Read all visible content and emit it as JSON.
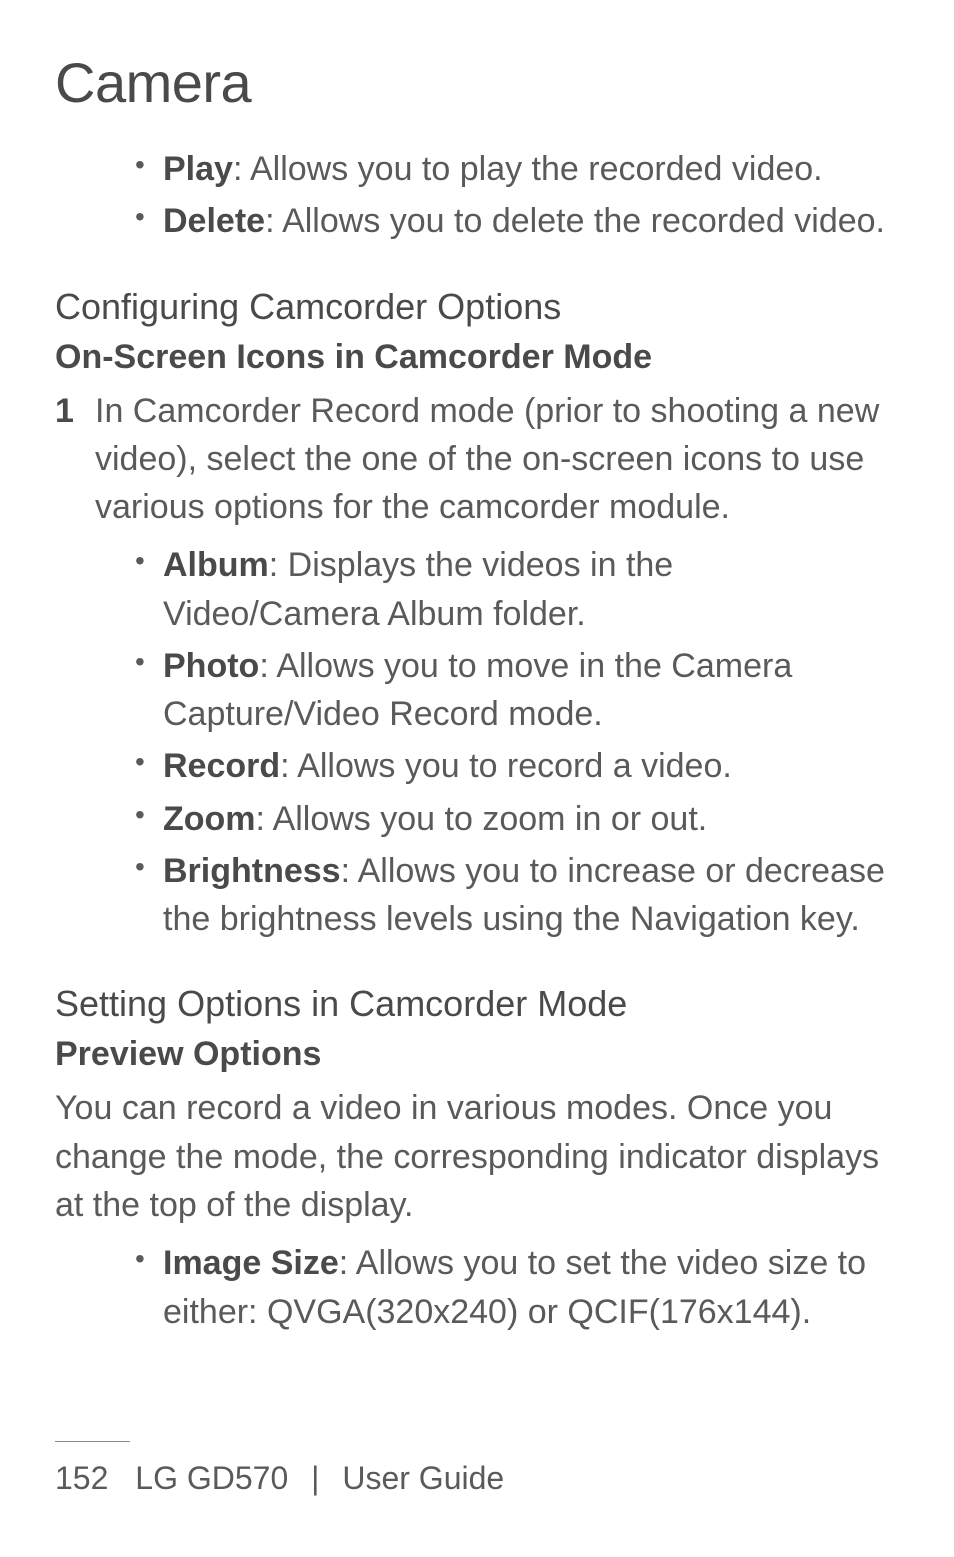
{
  "title": "Camera",
  "top_bullets": [
    {
      "label": "Play",
      "text": ": Allows you to play the recorded video."
    },
    {
      "label": "Delete",
      "text": ": Allows you to delete the recorded video."
    }
  ],
  "section1": {
    "heading": "Configuring Camcorder Options",
    "sub": "On-Screen Icons in Camcorder Mode",
    "step_num": "1",
    "step_text": "In Camcorder Record mode (prior to shooting a new video), select the one of the on-screen icons to use various options for the camcorder module.",
    "bullets": [
      {
        "label": "Album",
        "text": ": Displays the videos in the Video/Camera Album folder."
      },
      {
        "label": "Photo",
        "text": ": Allows you to move in the Camera Capture/Video Record mode."
      },
      {
        "label": "Record",
        "text": ": Allows you to record a video."
      },
      {
        "label": "Zoom",
        "text": ": Allows you to zoom in or out."
      },
      {
        "label": "Brightness",
        "text": ": Allows you to increase or decrease the brightness levels using the Navigation key."
      }
    ]
  },
  "section2": {
    "heading": "Setting Options in Camcorder Mode",
    "sub": "Preview Options",
    "body": "You can record a video in various modes. Once you change the mode, the corresponding indicator displays at the top of the display.",
    "bullets": [
      {
        "label": "Image Size",
        "text": ": Allows you to set the video size to either: QVGA(320x240) or QCIF(176x144)."
      }
    ]
  },
  "footer": {
    "page": "152",
    "product": "LG GD570",
    "guide": "User Guide"
  }
}
